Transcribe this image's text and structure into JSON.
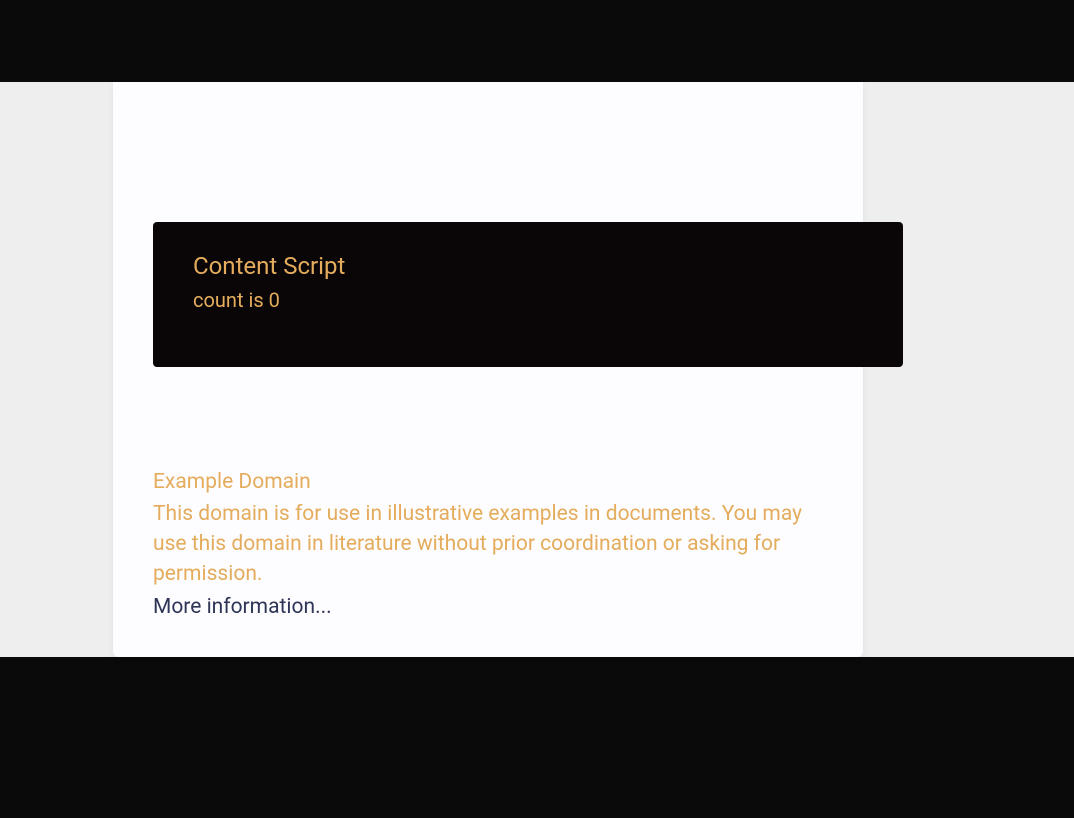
{
  "contentScript": {
    "title": "Content Script",
    "countLabel": "count is 0"
  },
  "example": {
    "heading": "Example Domain",
    "body": "This domain is for use in illustrative examples in documents. You may use this domain in literature without prior coordination or asking for permission.",
    "moreLink": "More information..."
  }
}
